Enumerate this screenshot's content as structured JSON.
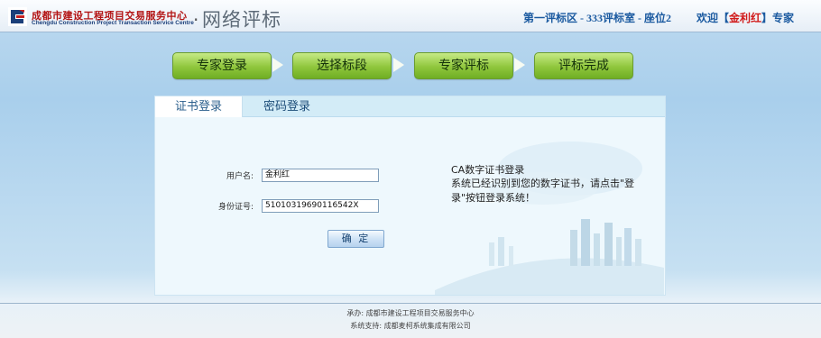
{
  "header": {
    "org_name_cn": "成都市建设工程项目交易服务中心",
    "org_name_en": "Chengdu Construction Project Transaction Service Centre",
    "separator": ".",
    "system_name": "网络评标",
    "session_info": "第一评标区 - 333评标室 - 座位2",
    "welcome_prefix": "欢迎【",
    "user_name": "金利红",
    "welcome_suffix": "】专家"
  },
  "steps": [
    "专家登录",
    "选择标段",
    "专家评标",
    "评标完成"
  ],
  "tabs": {
    "certificate": "证书登录",
    "password": "密码登录"
  },
  "form": {
    "username_label": "用户名:",
    "username_value": "金利红",
    "id_label": "身份证号:",
    "id_value": "51010319690116542X",
    "confirm_label": "确 定"
  },
  "ca": {
    "title": "CA数字证书登录",
    "description": "系统已经识别到您的数字证书，请点击\"登录\"按钮登录系统！"
  },
  "footer": {
    "organizer": "承办: 成都市建设工程项目交易服务中心",
    "support": "系统支持: 成都麦柯系统集成有限公司"
  },
  "colors": {
    "step_green": "#8fc63c",
    "brand_red": "#b31414",
    "link_blue": "#1b5aa0"
  }
}
